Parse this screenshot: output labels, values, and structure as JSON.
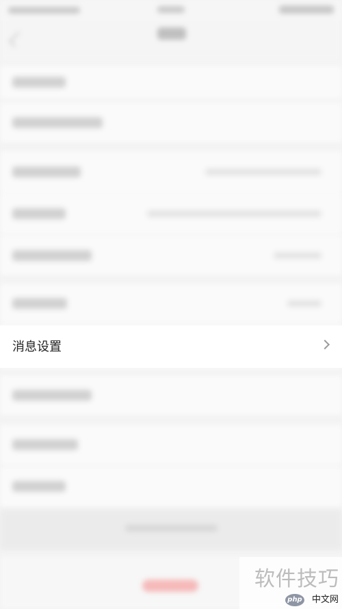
{
  "screen": {
    "message_settings_label": "消息设置"
  },
  "watermark": {
    "main_text": "软件技巧",
    "logo_badge": "php",
    "logo_text": "中文网"
  },
  "colors": {
    "background": "#f3f3f3",
    "row_background": "#ffffff",
    "text_primary": "#222222",
    "chevron": "#9a9a9a",
    "watermark": "#bcbcbc",
    "logout_blur": "#f7b7b7"
  }
}
